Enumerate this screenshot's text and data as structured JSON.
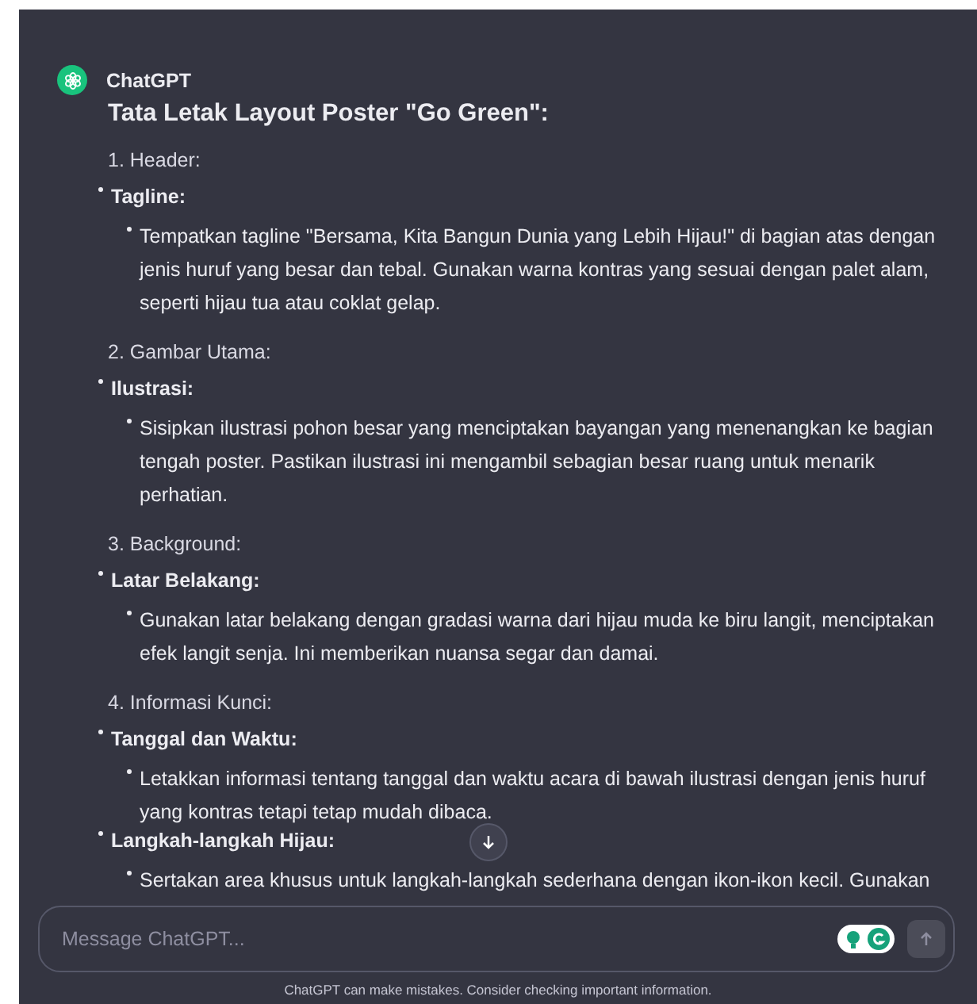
{
  "message": {
    "author": "ChatGPT",
    "title": "Tata Letak Layout Poster \"Go Green\":",
    "sections": [
      {
        "heading": "1. Header:",
        "items": [
          {
            "label": "Tagline:",
            "lines": [
              "Tempatkan tagline \"Bersama, Kita Bangun Dunia yang Lebih Hijau!\" di bagian atas dengan",
              "jenis huruf yang besar dan tebal. Gunakan warna kontras yang sesuai dengan palet alam,",
              "seperti hijau tua atau coklat gelap."
            ]
          }
        ]
      },
      {
        "heading": "2. Gambar Utama:",
        "items": [
          {
            "label": "Ilustrasi:",
            "lines": [
              "Sisipkan ilustrasi pohon besar yang menciptakan bayangan yang menenangkan ke bagian",
              "tengah poster. Pastikan ilustrasi ini mengambil sebagian besar ruang untuk menarik",
              "perhatian."
            ]
          }
        ]
      },
      {
        "heading": "3. Background:",
        "items": [
          {
            "label": "Latar Belakang:",
            "lines": [
              "Gunakan latar belakang dengan gradasi warna dari hijau muda ke biru langit, menciptakan",
              "efek langit senja. Ini memberikan nuansa segar dan damai."
            ]
          }
        ]
      },
      {
        "heading": "4. Informasi Kunci:",
        "items": [
          {
            "label": "Tanggal dan Waktu:",
            "lines": [
              "Letakkan informasi tentang tanggal dan waktu acara di bawah ilustrasi dengan jenis huruf",
              "yang kontras tetapi tetap mudah dibaca."
            ]
          },
          {
            "label": "Langkah-langkah Hijau:",
            "lines": [
              "Sertakan area khusus untuk langkah-langkah sederhana dengan ikon-ikon kecil. Gunakan"
            ]
          }
        ]
      }
    ]
  },
  "composer": {
    "placeholder": "Message ChatGPT..."
  },
  "footer": "ChatGPT can make mistakes. Consider checking important information."
}
